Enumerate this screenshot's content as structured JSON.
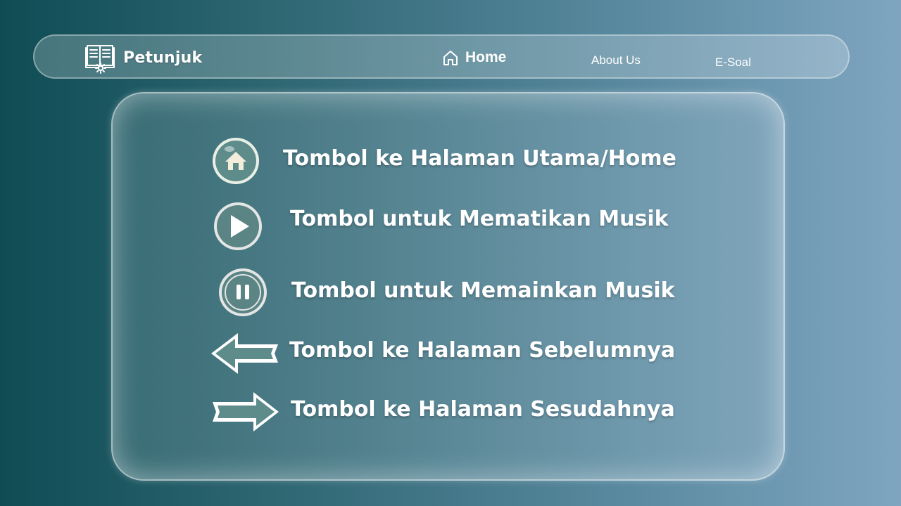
{
  "navbar": {
    "brand_label": "Petunjuk",
    "brand_icon": "book-gear-icon",
    "links": [
      {
        "label": "Home",
        "icon": "home-outline-icon"
      },
      {
        "label": "About Us"
      },
      {
        "label": "E-Soal"
      }
    ]
  },
  "legend": {
    "items": [
      {
        "icon": "home-button-icon",
        "label": "Tombol ke Halaman Utama/Home"
      },
      {
        "icon": "play-button-icon",
        "label": "Tombol untuk Mematikan Musik"
      },
      {
        "icon": "pause-button-icon",
        "label": "Tombol untuk Memainkan Musik"
      },
      {
        "icon": "arrow-left-icon",
        "label": "Tombol ke Halaman Sebelumnya"
      },
      {
        "icon": "arrow-right-icon",
        "label": "Tombol ke Halaman Sesudahnya"
      }
    ]
  },
  "colors": {
    "background_start": "#0f4c54",
    "background_end": "#7fa5c1",
    "icon_fill": "#5e8c8a",
    "icon_cream": "#f3eedb"
  }
}
